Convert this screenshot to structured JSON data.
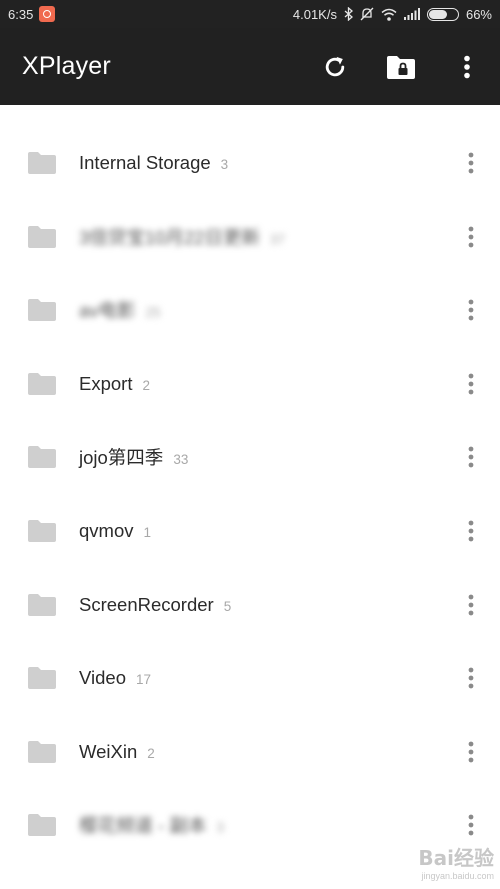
{
  "status_bar": {
    "time": "6:35",
    "net_speed": "4.01K/s",
    "battery": "66%",
    "battery_level": 0.66,
    "icons": [
      "app-notification-icon",
      "bluetooth-icon",
      "mute-icon",
      "wifi-icon",
      "signal-icon",
      "battery-icon"
    ]
  },
  "app_bar": {
    "title": "XPlayer",
    "actions": [
      "refresh-icon",
      "private-folder-icon",
      "overflow-menu-icon"
    ]
  },
  "folders": [
    {
      "name": "Internal Storage",
      "count": "3",
      "obscured": false
    },
    {
      "name": "3倍贷宝10月22日更新",
      "count": "37",
      "obscured": true
    },
    {
      "name": "av电影",
      "count": "25",
      "obscured": true
    },
    {
      "name": "Export",
      "count": "2",
      "obscured": false
    },
    {
      "name": "jojo第四季",
      "count": "33",
      "obscured": false
    },
    {
      "name": "qvmov",
      "count": "1",
      "obscured": false
    },
    {
      "name": "ScreenRecorder",
      "count": "5",
      "obscured": false
    },
    {
      "name": "Video",
      "count": "17",
      "obscured": false
    },
    {
      "name": "WeiXin",
      "count": "2",
      "obscured": false
    },
    {
      "name": "樱花频道 - 副本",
      "count": "3",
      "obscured": true
    }
  ],
  "watermark": {
    "main": "Bai经验",
    "sub": "jingyan.baidu.com"
  },
  "colors": {
    "app_bar": "#212121",
    "status_bar": "#222222",
    "folder_icon": "#cfcfcf",
    "count_text": "#a8a8a8"
  }
}
